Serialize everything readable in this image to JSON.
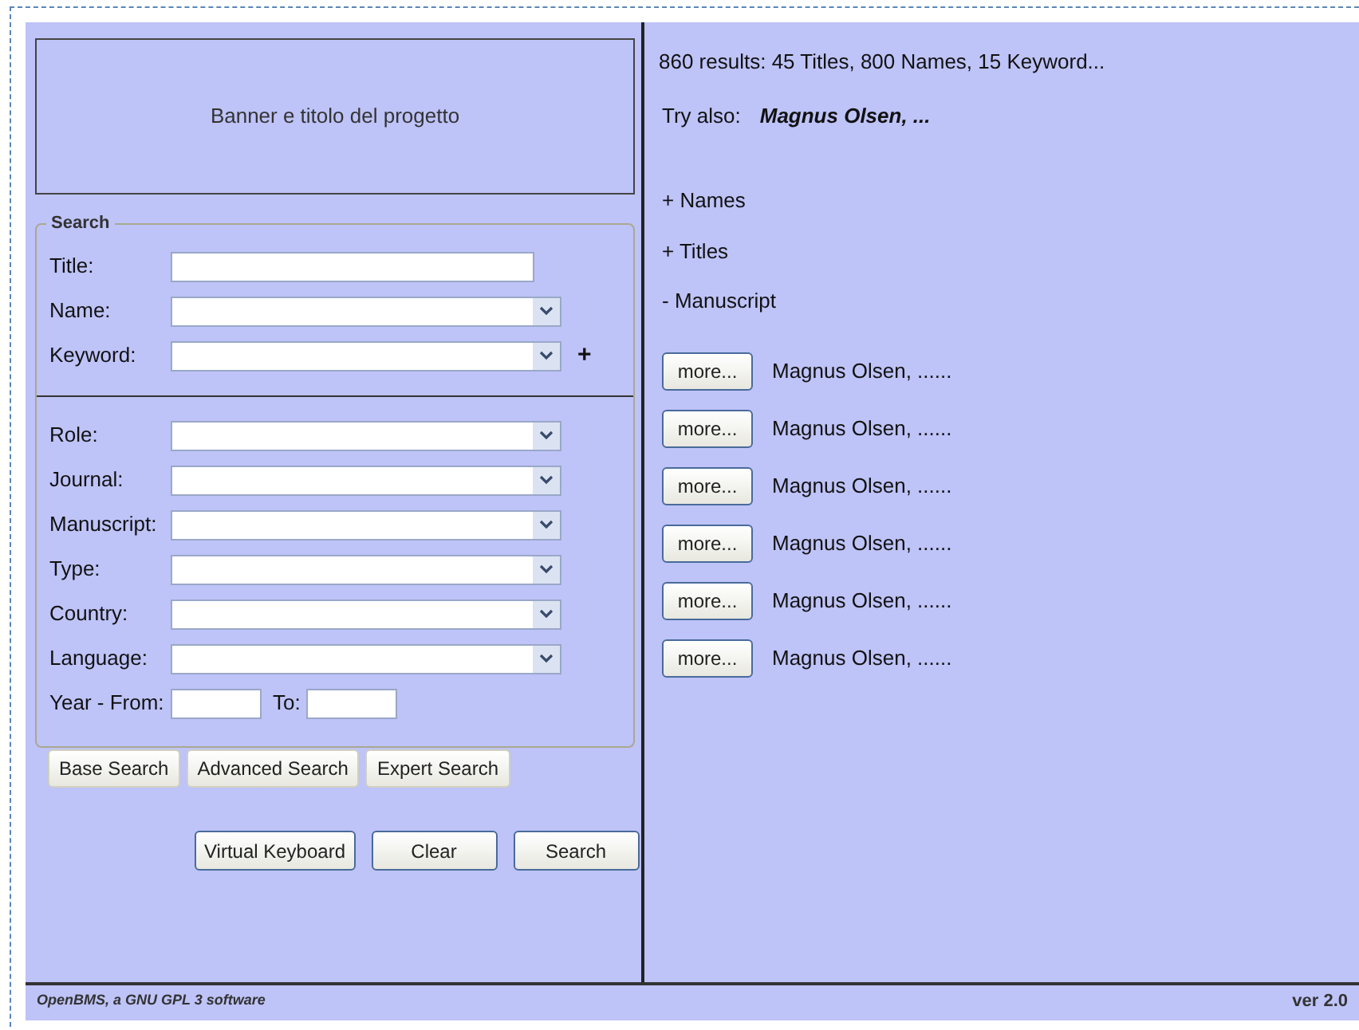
{
  "banner": "Banner e titolo del progetto",
  "search": {
    "legend": "Search",
    "basic_fields": [
      {
        "label": "Title:",
        "kind": "text"
      },
      {
        "label": "Name:",
        "kind": "select"
      },
      {
        "label": "Keyword:",
        "kind": "select",
        "add": "+"
      }
    ],
    "advanced_fields": [
      {
        "label": "Role:",
        "kind": "select"
      },
      {
        "label": "Journal:",
        "kind": "select"
      },
      {
        "label": "Manuscript:",
        "kind": "select"
      },
      {
        "label": "Type:",
        "kind": "select"
      },
      {
        "label": "Country:",
        "kind": "select"
      },
      {
        "label": "Language:",
        "kind": "select"
      }
    ],
    "year": {
      "from_label": "Year - From:",
      "to_label": "To:"
    }
  },
  "mode_buttons": [
    "Base Search",
    "Advanced Search",
    "Expert Search"
  ],
  "action_buttons": [
    "Virtual Keyboard",
    "Clear",
    "Search"
  ],
  "results": {
    "summary": "860 results: 45 Titles, 800 Names, 15 Keyword...",
    "try_label": "Try also:",
    "try_value": "Magnus Olsen, ...",
    "groups": [
      "+ Names",
      "+ Titles",
      "- Manuscript"
    ],
    "items": [
      {
        "button": "more...",
        "text": "Magnus Olsen, ......"
      },
      {
        "button": "more...",
        "text": "Magnus Olsen, ......"
      },
      {
        "button": "more...",
        "text": "Magnus Olsen, ......"
      },
      {
        "button": "more...",
        "text": "Magnus Olsen, ......"
      },
      {
        "button": "more...",
        "text": "Magnus Olsen, ......"
      },
      {
        "button": "more...",
        "text": "Magnus Olsen, ......"
      }
    ]
  },
  "footer": {
    "left": "OpenBMS, a GNU GPL 3 software",
    "right": "ver 2.0"
  }
}
